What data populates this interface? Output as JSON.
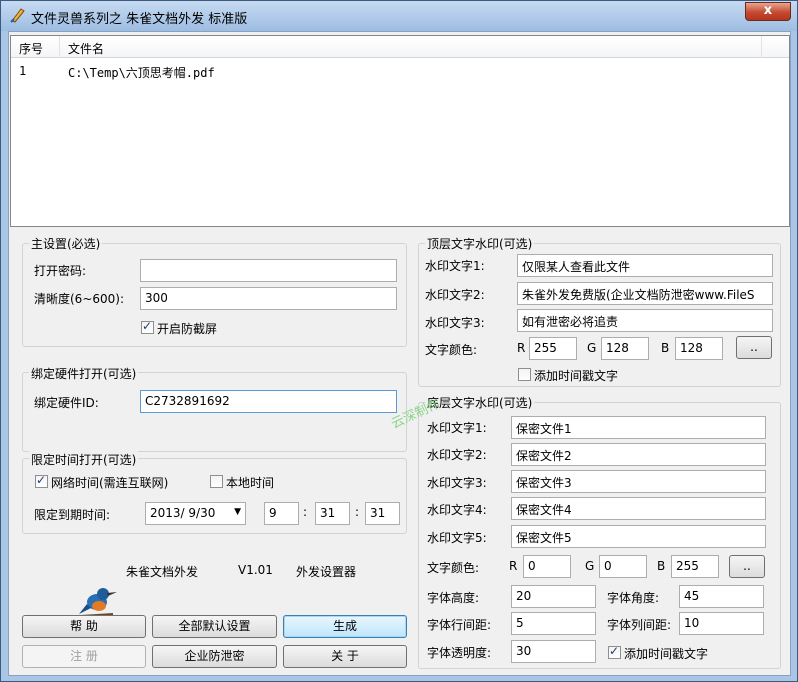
{
  "window": {
    "title": "文件灵兽系列之 朱雀文档外发 标准版",
    "close": "x"
  },
  "filelist": {
    "col_index": "序号",
    "col_name": "文件名",
    "rows": [
      {
        "index": "1",
        "name": "C:\\Temp\\六顶思考帽.pdf"
      }
    ]
  },
  "main_settings": {
    "legend": "主设置(必选)",
    "open_password_label": "打开密码:",
    "open_password_value": "",
    "clarity_label": "清晰度(6~600):",
    "clarity_value": "300",
    "anti_screenshot_label": "开启防截屏"
  },
  "hardware": {
    "legend": "绑定硬件打开(可选)",
    "id_label": "绑定硬件ID:",
    "id_value": "C2732891692"
  },
  "time_limit": {
    "legend": "限定时间打开(可选)",
    "network_time_label": "网络时间(需连互联网)",
    "local_time_label": "本地时间",
    "expire_label": "限定到期时间:",
    "date_value": "2013/ 9/30",
    "hour": "9",
    "minute": "31",
    "second": "31",
    "colon": ":"
  },
  "about": {
    "product": "朱雀文档外发",
    "version": "V1.01",
    "subtitle": "外发设置器"
  },
  "buttons": {
    "help": "帮  助",
    "defaults": "全部默认设置",
    "generate": "生成",
    "register": "注  册",
    "enterprise": "企业防泄密",
    "about": "关  于",
    "color_picker": ".."
  },
  "top_watermark": {
    "legend": "顶层文字水印(可选)",
    "text1_label": "水印文字1:",
    "text1": "仅限某人查看此文件",
    "text2_label": "水印文字2:",
    "text2": "朱雀外发免费版(企业文档防泄密www.FileS",
    "text3_label": "水印文字3:",
    "text3": "如有泄密必将追责",
    "color_label": "文字颜色:",
    "r_label": "R",
    "r": "255",
    "g_label": "G",
    "g": "128",
    "b_label": "B",
    "b": "128",
    "timestamp_label": "添加时间戳文字"
  },
  "bottom_watermark": {
    "legend": "底层文字水印(可选)",
    "text1_label": "水印文字1:",
    "text1": "保密文件1",
    "text2_label": "水印文字2:",
    "text2": "保密文件2",
    "text3_label": "水印文字3:",
    "text3": "保密文件3",
    "text4_label": "水印文字4:",
    "text4": "保密文件4",
    "text5_label": "水印文字5:",
    "text5": "保密文件5",
    "color_label": "文字颜色:",
    "r_label": "R",
    "r": "0",
    "g_label": "G",
    "g": "0",
    "b_label": "B",
    "b": "255",
    "height_label": "字体高度:",
    "height": "20",
    "angle_label": "字体角度:",
    "angle": "45",
    "line_spacing_label": "字体行间距:",
    "line_spacing": "5",
    "col_spacing_label": "字体列间距:",
    "col_spacing": "10",
    "opacity_label": "字体透明度:",
    "opacity": "30",
    "timestamp_label": "添加时间戳文字"
  },
  "overlay": {
    "watermark_text": "云深制作"
  },
  "colors": {
    "title_bar": "#a9c6e6",
    "primary_button": "#bee6fd",
    "watermark_green": "#7fd47f"
  },
  "icons": {
    "app": "bird-brush-icon",
    "close": "close-icon",
    "logo": "kingfisher-icon"
  }
}
